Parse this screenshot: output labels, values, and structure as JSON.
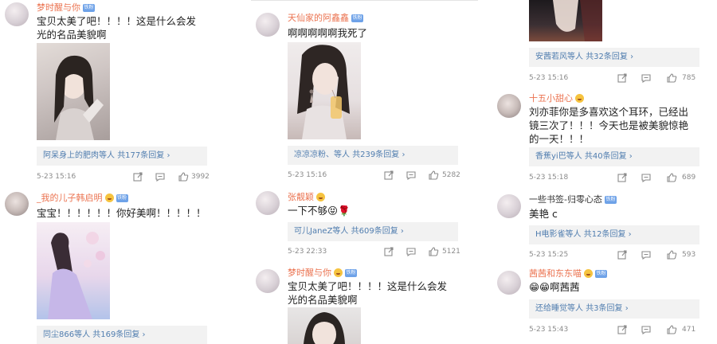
{
  "columns": [
    {
      "comments": [
        {
          "username": "梦时醒与你",
          "text": "宝贝太美了吧！！！！这是什么会发光的名品美貌啊",
          "replies_who": "阿呆身上的肥肉等人",
          "replies_count": "共177条回复 ›",
          "time": "5-23 15:16",
          "likes": "3992"
        },
        {
          "username": "_我的儿子韩启明",
          "text": "宝宝！！！！！！你好美啊！！！！！",
          "replies_who": "同尘866等人",
          "replies_count": "共169条回复 ›"
        }
      ]
    },
    {
      "comments": [
        {
          "username": "天仙家的阿鑫鑫",
          "text": "啊啊啊啊啊我死了",
          "replies_who": "凉凉凉粉、等人",
          "replies_count": "共239条回复 ›",
          "time": "5-23 15:16",
          "likes": "5282"
        },
        {
          "username": "张靓颖",
          "text": "一下不够😝🌹",
          "replies_who": "可儿JaneZ等人",
          "replies_count": "共609条回复 ›",
          "time": "5-23 22:33",
          "likes": "5121"
        },
        {
          "username": "梦时醒与你",
          "text": "宝贝太美了吧！！！！这是什么会发光的名品美貌啊"
        }
      ]
    },
    {
      "comments": [
        {
          "replies_who": "安茜若风等人",
          "replies_count": "共32条回复 ›",
          "time": "5-23 15:16",
          "likes": "785"
        },
        {
          "username": "十五小甜心",
          "text": "刘亦菲你是多喜欢这个耳环，已经出镜三次了！！！今天也是被美貌惊艳的一天！！！",
          "replies_who": "香蕉yi巴等人",
          "replies_count": "共40条回复 ›",
          "time": "5-23 15:18",
          "likes": "689"
        },
        {
          "username": "一些书签-归零心态",
          "text": "美艳 c",
          "replies_who": "H电影雀等人",
          "replies_count": "共12条回复 ›",
          "time": "5-23 15:25",
          "likes": "593"
        },
        {
          "username": "茜茜和东东喵",
          "text": "😁😁啊茜茜",
          "replies_who": "还给睡觉等人",
          "replies_count": "共3条回复 ›",
          "time": "5-23 15:43",
          "likes": "471"
        }
      ]
    }
  ],
  "badges": {
    "vip_label": "铁粉"
  },
  "colors": {
    "username": "#eb7350",
    "link": "#507daf",
    "meta": "#8b8b8b",
    "replies_bg": "#f2f2f2"
  }
}
